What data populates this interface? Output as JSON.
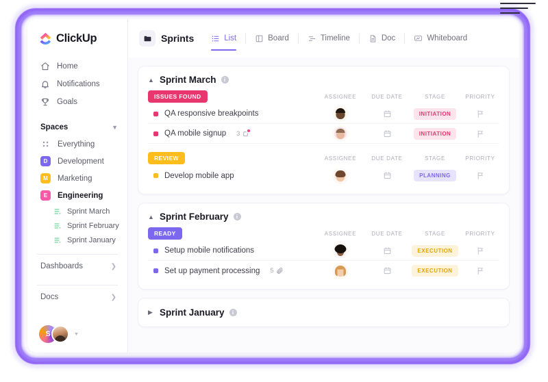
{
  "brand": {
    "name": "ClickUp"
  },
  "sidebar": {
    "nav": [
      {
        "label": "Home",
        "icon": "home-icon"
      },
      {
        "label": "Notifications",
        "icon": "bell-icon"
      },
      {
        "label": "Goals",
        "icon": "trophy-icon"
      }
    ],
    "spaces_header": "Spaces",
    "spaces": [
      {
        "label": "Everything",
        "type": "grid",
        "letter": "",
        "color": ""
      },
      {
        "label": "Development",
        "type": "chip",
        "letter": "D",
        "color": "#7b68ee"
      },
      {
        "label": "Marketing",
        "type": "chip",
        "letter": "M",
        "color": "#fdbd1d"
      },
      {
        "label": "Engineering",
        "type": "chip",
        "letter": "E",
        "color": "#f957a8",
        "active": true
      }
    ],
    "lists": [
      {
        "label": "Sprint  March"
      },
      {
        "label": "Sprint  February"
      },
      {
        "label": "Sprint January"
      }
    ],
    "footer": [
      {
        "label": "Dashboards"
      },
      {
        "label": "Docs"
      }
    ],
    "user": {
      "initial": "S"
    }
  },
  "toolbar": {
    "title": "Sprints",
    "tabs": [
      {
        "label": "List",
        "icon": "list-icon",
        "active": true
      },
      {
        "label": "Board",
        "icon": "board-icon",
        "active": false
      },
      {
        "label": "Timeline",
        "icon": "timeline-icon",
        "active": false
      },
      {
        "label": "Doc",
        "icon": "doc-icon",
        "active": false
      },
      {
        "label": "Whiteboard",
        "icon": "whiteboard-icon",
        "active": false
      }
    ]
  },
  "columns": [
    "ASSIGNEE",
    "DUE DATE",
    "STAGE",
    "PRIORITY"
  ],
  "sprints": [
    {
      "name": "Sprint March",
      "expanded": true,
      "groups": [
        {
          "status": "ISSUES FOUND",
          "status_color": "#e8366f",
          "tasks": [
            {
              "name": "QA responsive breakpoints",
              "dot_color": "#e8366f",
              "count": "",
              "meta_icon": "",
              "avatar": "a1",
              "stage": "INITIATION",
              "stage_bg": "#fde3ec",
              "stage_fg": "#e8366f"
            },
            {
              "name": "QA mobile signup",
              "dot_color": "#e8366f",
              "count": "3",
              "meta_icon": "subtask-icon",
              "avatar": "a2",
              "stage": "INITIATION",
              "stage_bg": "#fde3ec",
              "stage_fg": "#e8366f"
            }
          ]
        },
        {
          "status": "REVIEW",
          "status_color": "#fdbd1d",
          "tasks": [
            {
              "name": "Develop mobile app",
              "dot_color": "#fdbd1d",
              "count": "",
              "meta_icon": "",
              "avatar": "a3",
              "stage": "PLANNING",
              "stage_bg": "#e7e3fd",
              "stage_fg": "#7b68ee"
            }
          ]
        }
      ]
    },
    {
      "name": "Sprint February",
      "expanded": true,
      "groups": [
        {
          "status": "READY",
          "status_color": "#7b68ee",
          "tasks": [
            {
              "name": "Setup mobile notifications",
              "dot_color": "#7b68ee",
              "count": "",
              "meta_icon": "",
              "avatar": "a4",
              "stage": "EXECUTION",
              "stage_bg": "#fdf3da",
              "stage_fg": "#e0a309"
            },
            {
              "name": "Set up payment processing",
              "dot_color": "#7b68ee",
              "count": "5",
              "meta_icon": "attachment-icon",
              "avatar": "a5",
              "stage": "EXECUTION",
              "stage_bg": "#fdf3da",
              "stage_fg": "#e0a309"
            }
          ]
        }
      ]
    },
    {
      "name": "Sprint January",
      "expanded": false,
      "groups": []
    }
  ],
  "theme": {
    "accent": "#7b68ee",
    "frame": "#8b5cf6",
    "pink": "#e8366f",
    "yellow": "#fdbd1d",
    "green": "#49cc7f"
  }
}
